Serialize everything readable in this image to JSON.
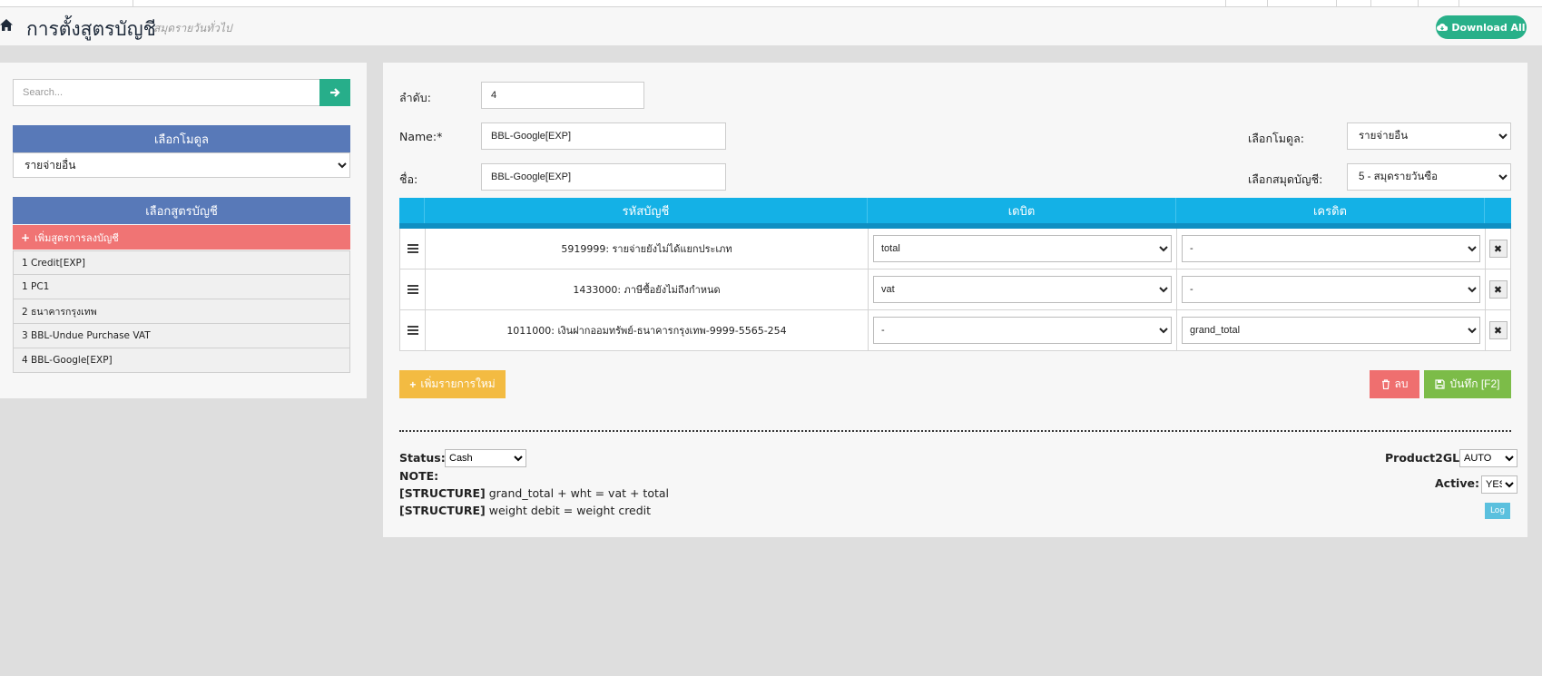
{
  "header": {
    "title": "การตั้งสูตรบัญชี",
    "subtitle": "สมุดรายวันทั่วไป",
    "download_label": "Download All"
  },
  "sidebar": {
    "search_placeholder": "Search...",
    "module_header": "เลือกโมดูล",
    "module_selected": "รายจ่ายอื่น",
    "formula_header": "เลือกสูตรบัญชี",
    "add_formula_label": "เพิ่มสูตรการลงบัญชี",
    "items": [
      {
        "label": "1 Credit[EXP]"
      },
      {
        "label": "1 PC1"
      },
      {
        "label": "2 ธนาคารกรุงเทพ"
      },
      {
        "label": "3 BBL-Undue Purchase VAT"
      },
      {
        "label": "4 BBL-Google[EXP]"
      }
    ]
  },
  "form": {
    "order_label": "ลำดับ:",
    "order_value": "4",
    "name_label": "Name:*",
    "name_value": "BBL-Google[EXP]",
    "thai_name_label": "ชื่อ:",
    "thai_name_value": "BBL-Google[EXP]",
    "module_label": "เลือกโมดูล:",
    "module_value": "รายจ่ายอื่น",
    "journal_label": "เลือกสมุดบัญชี:",
    "journal_value": "5 - สมุดรายวันซื้อ"
  },
  "table": {
    "headers": {
      "code": "รหัสบัญชี",
      "debit": "เดบิต",
      "credit": "เครดิต"
    },
    "rows": [
      {
        "code": "5919999: รายจ่ายยังไม่ได้แยกประเภท",
        "debit": "total",
        "credit": "-"
      },
      {
        "code": "1433000: ภาษีซื้อยังไม่ถึงกำหนด",
        "debit": "vat",
        "credit": "-"
      },
      {
        "code": "1011000: เงินฝากออมทรัพย์-ธนาคารกรุงเทพ-9999-5565-254",
        "debit": "-",
        "credit": "grand_total"
      }
    ]
  },
  "actions": {
    "add_label": "เพิ่มรายการใหม่",
    "delete_label": "ลบ",
    "save_label": "บันทึก [F2]"
  },
  "footer": {
    "status_label": "Status:",
    "status_value": "Cash",
    "note_label": "NOTE:",
    "structure_tag": "[STRUCTURE]",
    "structure1": "grand_total + wht = vat + total",
    "structure2": "weight debit = weight credit",
    "product2gl_label": "Product2GL:",
    "product2gl_value": "AUTO",
    "active_label": "Active:",
    "active_value": "YES",
    "log_label": "Log"
  },
  "colors": {
    "accent_green": "#28b089",
    "sidebar_header": "#5879b8",
    "add_formula": "#f07474",
    "table_header": "#14b1e6",
    "add_button": "#f3bb42",
    "delete_button": "#ef6f6f",
    "save_button": "#7cbc48",
    "log_button": "#5bc0de"
  }
}
